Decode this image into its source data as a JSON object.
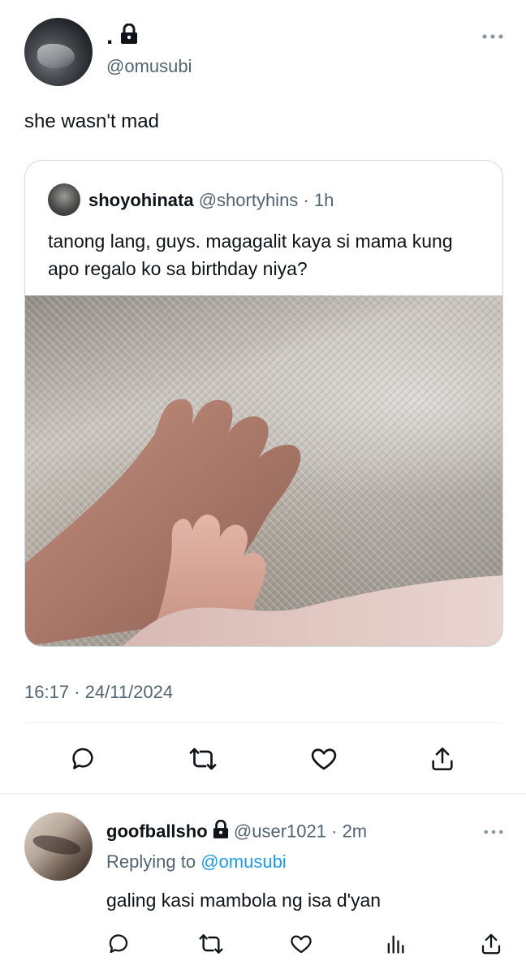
{
  "tweet": {
    "author": {
      "display_name": ".",
      "handle": "@omusubi",
      "locked": true
    },
    "text": "she wasn't mad",
    "quoted": {
      "author_name": "shoyohinata",
      "handle": "@shortyhins",
      "separator": "·",
      "age": "1h",
      "text": "tanong lang, guys. magagalit kaya si mama kung apo regalo ko sa birthday niya?"
    },
    "time": "16:17",
    "time_sep": "·",
    "date": "24/11/2024",
    "actions": [
      "reply-icon",
      "retweet-icon",
      "like-icon",
      "share-icon"
    ]
  },
  "reply": {
    "author_name": "goofballsho",
    "locked": true,
    "handle": "@user1021",
    "separator": "·",
    "age": "2m",
    "replying_prefix": "Replying to",
    "replying_to": "@omusubi",
    "text": "galing kasi mambola ng isa d'yan",
    "actions": [
      "reply-icon",
      "retweet-icon",
      "like-icon",
      "views-icon",
      "share-icon"
    ]
  },
  "colors": {
    "text": "#0f1419",
    "muted": "#536471",
    "link": "#1d9bf0",
    "border": "#cfd9de"
  }
}
